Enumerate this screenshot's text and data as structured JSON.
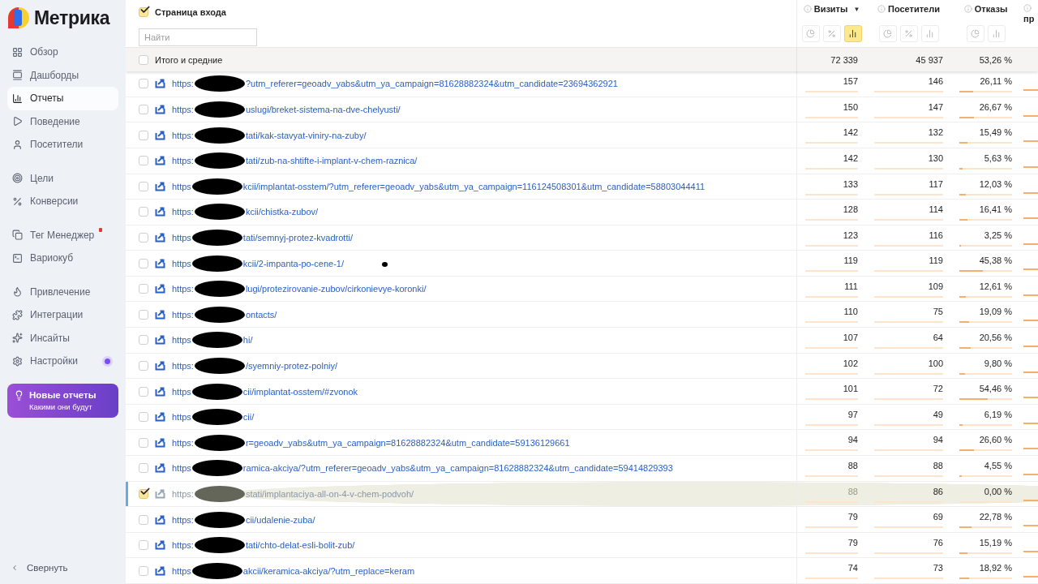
{
  "sidebar": {
    "logo": "Метрика",
    "groups": [
      {
        "items": [
          {
            "label": "Обзор",
            "selected": false
          },
          {
            "label": "Дашборды",
            "selected": false
          },
          {
            "label": "Отчеты",
            "selected": true
          },
          {
            "label": "Поведение",
            "selected": false
          },
          {
            "label": "Посетители",
            "selected": false
          }
        ]
      },
      {
        "items": [
          {
            "label": "Цели",
            "selected": false
          },
          {
            "label": "Конверсии",
            "selected": false
          }
        ]
      },
      {
        "items": [
          {
            "label": "Тег Менеджер",
            "selected": false,
            "badge": true
          },
          {
            "label": "Вариокуб",
            "selected": false
          }
        ]
      },
      {
        "items": [
          {
            "label": "Привлечение",
            "selected": false
          },
          {
            "label": "Интеграции",
            "selected": false
          },
          {
            "label": "Инсайты",
            "selected": false
          },
          {
            "label": "Настройки",
            "selected": false,
            "dot": true
          }
        ]
      }
    ],
    "promo": {
      "title": "Новые отчеты",
      "subtitle": "Какими они будут"
    },
    "collapse": "Свернуть"
  },
  "table": {
    "dimension": {
      "label": "Страница входа",
      "checked": true
    },
    "search": {
      "placeholder": "Найти"
    },
    "columns": [
      {
        "label": "Визиты",
        "sort": "▼",
        "views": [
          {
            "kind": "pie",
            "selected": false
          },
          {
            "kind": "percent",
            "selected": false
          },
          {
            "kind": "bars",
            "selected": true
          }
        ]
      },
      {
        "label": "Посетители",
        "views": [
          {
            "kind": "pie",
            "selected": false
          },
          {
            "kind": "percent",
            "selected": false
          },
          {
            "kind": "bars",
            "selected": false
          }
        ]
      },
      {
        "label": "Отказы",
        "views": [
          {
            "kind": "pie",
            "selected": false
          },
          {
            "kind": "bars",
            "selected": false
          }
        ]
      },
      {
        "label": "пр"
      }
    ],
    "totals": {
      "label": "Итого и средние",
      "checked": false,
      "visits": "72 339",
      "visitors": "45 937",
      "bounce": "53,26 %"
    },
    "rows": [
      {
        "url_start": "https:",
        "url_end": "?utm_referer=geoadv_yabs&utm_ya_campaign=81628882324&utm_candidate=23694362921",
        "visits": "157",
        "visitors": "146",
        "bounce": "26,11 %",
        "level": 0.26,
        "selected": false
      },
      {
        "url_start": "https:",
        "url_end": "uslugi/breket-sistema-na-dve-chelyusti/",
        "visits": "150",
        "visitors": "147",
        "bounce": "26,67 %",
        "level": 0.27,
        "selected": false
      },
      {
        "url_start": "https:",
        "url_end": "tati/kak-stavyat-viniry-na-zuby/",
        "visits": "142",
        "visitors": "132",
        "bounce": "15,49 %",
        "level": 0.15,
        "selected": false
      },
      {
        "url_start": "https:",
        "url_end": "tati/zub-na-shtifte-i-implant-v-chem-raznica/",
        "visits": "142",
        "visitors": "130",
        "bounce": "5,63 %",
        "level": 0.06,
        "selected": false
      },
      {
        "url_start": "https",
        "url_end": "kcii/implantat-osstem/?utm_referer=geoadv_yabs&utm_ya_campaign=116124508301&utm_candidate=58803044411",
        "visits": "133",
        "visitors": "117",
        "bounce": "12,03 %",
        "level": 0.12,
        "selected": false
      },
      {
        "url_start": "https:",
        "url_end": "kcii/chistka-zubov/",
        "visits": "128",
        "visitors": "114",
        "bounce": "16,41 %",
        "level": 0.16,
        "selected": false
      },
      {
        "url_start": "https",
        "url_end": "tati/semnyj-protez-kvadrotti/",
        "visits": "123",
        "visitors": "116",
        "bounce": "3,25 %",
        "level": 0.03,
        "selected": false
      },
      {
        "url_start": "https",
        "url_end": "kcii/2-impanta-po-cene-1/",
        "visits": "119",
        "visitors": "119",
        "bounce": "45,38 %",
        "level": 0.45,
        "selected": false
      },
      {
        "url_start": "https:",
        "url_end": "lugi/protezirovanie-zubov/cirkonievye-koronki/",
        "visits": "111",
        "visitors": "109",
        "bounce": "12,61 %",
        "level": 0.13,
        "selected": false
      },
      {
        "url_start": "https:",
        "url_end": "ontacts/",
        "visits": "110",
        "visitors": "75",
        "bounce": "19,09 %",
        "level": 0.19,
        "selected": false
      },
      {
        "url_start": "https",
        "url_end": "hi/",
        "visits": "107",
        "visitors": "64",
        "bounce": "20,56 %",
        "level": 0.21,
        "selected": false
      },
      {
        "url_start": "https:",
        "url_end": "/syemniy-protez-polniy/",
        "visits": "102",
        "visitors": "100",
        "bounce": "9,80 %",
        "level": 0.1,
        "selected": false
      },
      {
        "url_start": "https",
        "url_end": "cii/implantat-osstem/#zvonok",
        "visits": "101",
        "visitors": "72",
        "bounce": "54,46 %",
        "level": 0.54,
        "selected": false
      },
      {
        "url_start": "https",
        "url_end": "cii/",
        "visits": "97",
        "visitors": "49",
        "bounce": "6,19 %",
        "level": 0.06,
        "selected": false
      },
      {
        "url_start": "https:",
        "url_end": "r=geoadv_yabs&utm_ya_campaign=81628882324&utm_candidate=59136129661",
        "visits": "94",
        "visitors": "94",
        "bounce": "26,60 %",
        "level": 0.27,
        "selected": false
      },
      {
        "url_start": "https",
        "url_end": "ramica-akciya/?utm_referer=geoadv_yabs&utm_ya_campaign=81628882324&utm_candidate=59414829393",
        "visits": "88",
        "visitors": "88",
        "bounce": "4,55 %",
        "level": 0.05,
        "selected": false
      },
      {
        "url_start": "https:",
        "url_end": "stati/implantaciya-all-on-4-v-chem-podvoh/",
        "visits": "88",
        "visitors": "86",
        "bounce": "0,00 %",
        "level": 0,
        "selected": true
      },
      {
        "url_start": "https:",
        "url_end": "cii/udalenie-zuba/",
        "visits": "79",
        "visitors": "69",
        "bounce": "22,78 %",
        "level": 0.23,
        "selected": false
      },
      {
        "url_start": "https:",
        "url_end": "tati/chto-delat-esli-bolit-zub/",
        "visits": "79",
        "visitors": "76",
        "bounce": "15,19 %",
        "level": 0.15,
        "selected": false
      },
      {
        "url_start": "https",
        "url_end": "akcii/keramica-akciya/?utm_replace=keram",
        "visits": "74",
        "visitors": "73",
        "bounce": "18,92 %",
        "level": 0.19,
        "selected": false
      }
    ]
  }
}
